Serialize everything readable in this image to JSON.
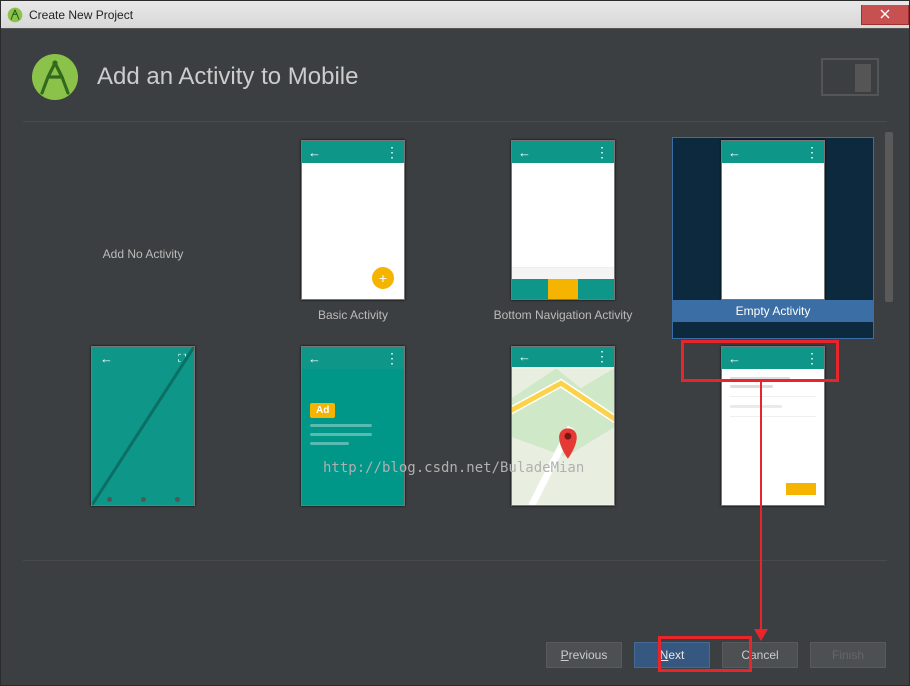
{
  "window": {
    "title": "Create New Project"
  },
  "header": {
    "title": "Add an Activity to Mobile"
  },
  "gallery": {
    "items": [
      {
        "label": "Add No Activity"
      },
      {
        "label": "Basic Activity"
      },
      {
        "label": "Bottom Navigation Activity"
      },
      {
        "label": "Empty Activity"
      }
    ]
  },
  "ad_label": "Ad",
  "watermark": "http://blog.csdn.net/BuladeMian",
  "buttons": {
    "previous": "Previous",
    "next": "Next",
    "cancel": "Cancel",
    "finish": "Finish"
  }
}
